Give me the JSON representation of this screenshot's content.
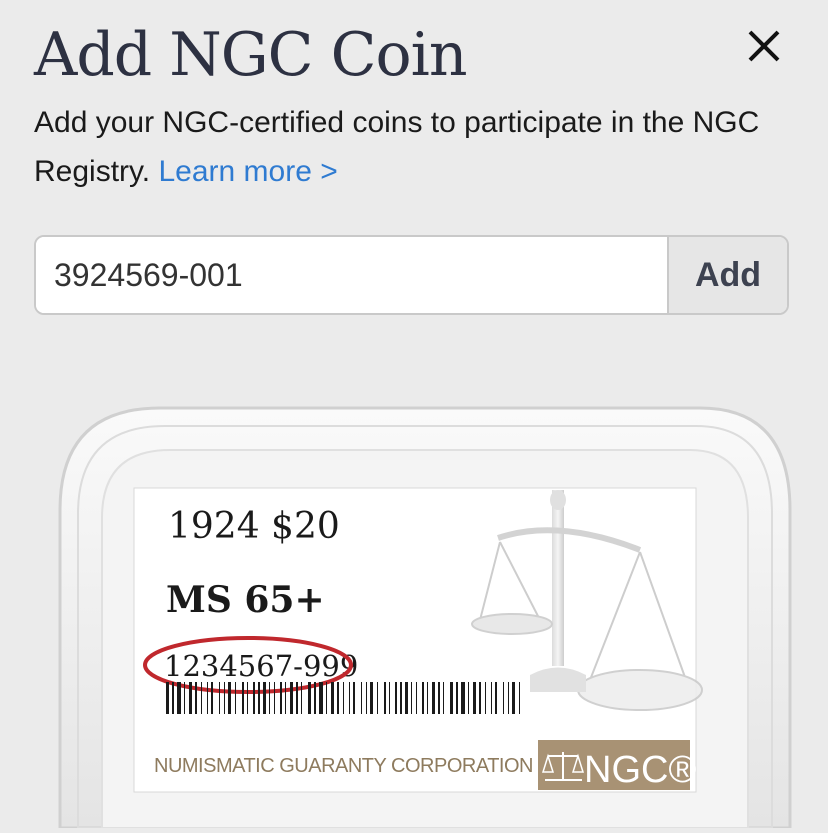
{
  "modal": {
    "title": "Add NGC Coin",
    "description": "Add your NGC-certified coins to participate in the NGC Registry.",
    "learn_more": "Learn more >"
  },
  "form": {
    "cert_value": "3924569-001",
    "add_label": "Add"
  },
  "slab_label": {
    "year_denom": "1924  $20",
    "grade": "MS 65+",
    "cert_number": "1234567-999",
    "company": "NUMISMATIC GUARANTY CORPORATION",
    "logo": "NGC®"
  },
  "colors": {
    "highlight_circle": "#c0282d",
    "logo_band": "#a89274",
    "link": "#2f7bd1"
  }
}
